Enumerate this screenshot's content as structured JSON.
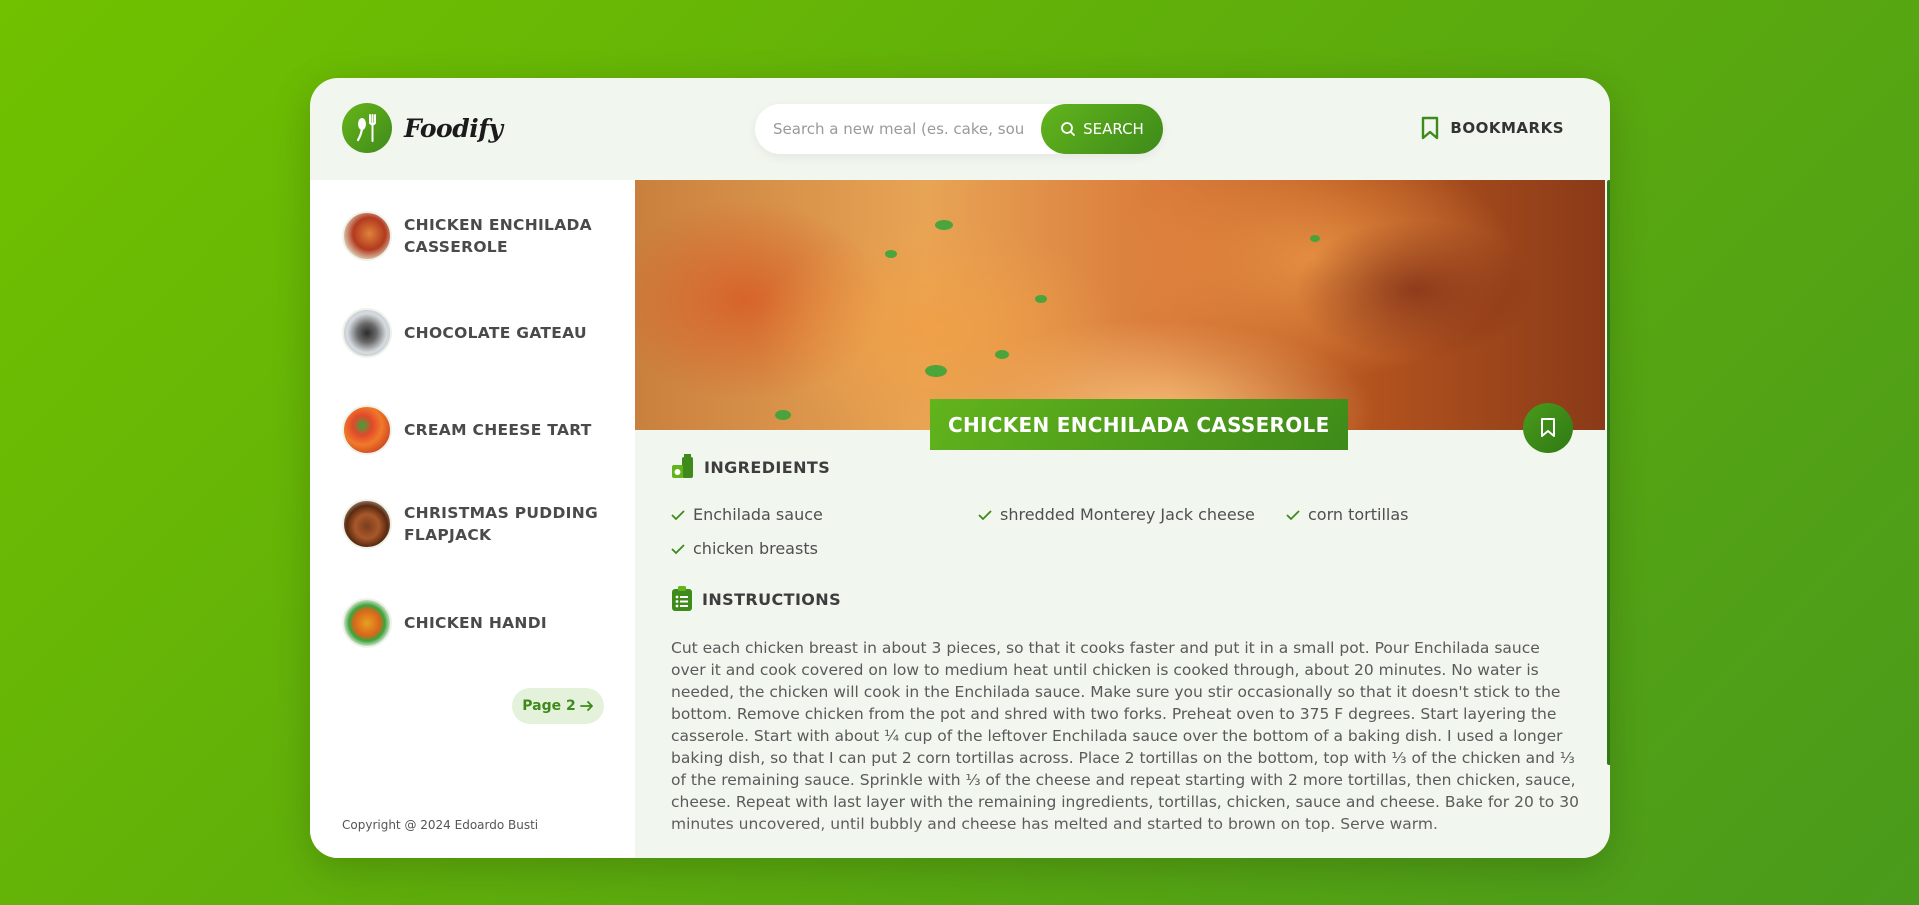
{
  "app": {
    "name": "Foodify"
  },
  "search": {
    "placeholder": "Search a new meal (es. cake, soup)",
    "button_label": "SEARCH"
  },
  "header": {
    "bookmarks_label": "BOOKMARKS"
  },
  "results": [
    {
      "title": "CHICKEN ENCHILADA CASSEROLE"
    },
    {
      "title": "CHOCOLATE GATEAU"
    },
    {
      "title": "CREAM CHEESE TART"
    },
    {
      "title": "CHRISTMAS PUDDING FLAPJACK"
    },
    {
      "title": "CHICKEN HANDI"
    }
  ],
  "pagination": {
    "next_label": "Page 2"
  },
  "footer": {
    "copyright": "Copyright @ 2024 Edoardo Busti"
  },
  "recipe": {
    "title": "CHICKEN ENCHILADA CASSEROLE",
    "ingredients_heading": "INGREDIENTS",
    "ingredients": [
      "Enchilada sauce",
      "shredded Monterey Jack cheese",
      "corn tortillas",
      "chicken breasts"
    ],
    "instructions_heading": "INSTRUCTIONS",
    "instructions": "Cut each chicken breast in about 3 pieces, so that it cooks faster and put it in a small pot. Pour Enchilada sauce over it and cook covered on low to medium heat until chicken is cooked through, about 20 minutes. No water is needed, the chicken will cook in the Enchilada sauce. Make sure you stir occasionally so that it doesn't stick to the bottom. Remove chicken from the pot and shred with two forks. Preheat oven to 375 F degrees. Start layering the casserole. Start with about ¼ cup of the leftover Enchilada sauce over the bottom of a baking dish. I used a longer baking dish, so that I can put 2 corn tortillas across. Place 2 tortillas on the bottom, top with ⅓ of the chicken and ⅓ of the remaining sauce. Sprinkle with ⅓ of the cheese and repeat starting with 2 more tortillas, then chicken, sauce, cheese. Repeat with last layer with the remaining ingredients, tortillas, chicken, sauce and cheese. Bake for 20 to 30 minutes uncovered, until bubbly and cheese has melted and started to brown on top. Serve warm."
  },
  "colors": {
    "accent": "#4a9a1c",
    "accent_light": "#71c100",
    "panel": "#f1f6ef"
  }
}
